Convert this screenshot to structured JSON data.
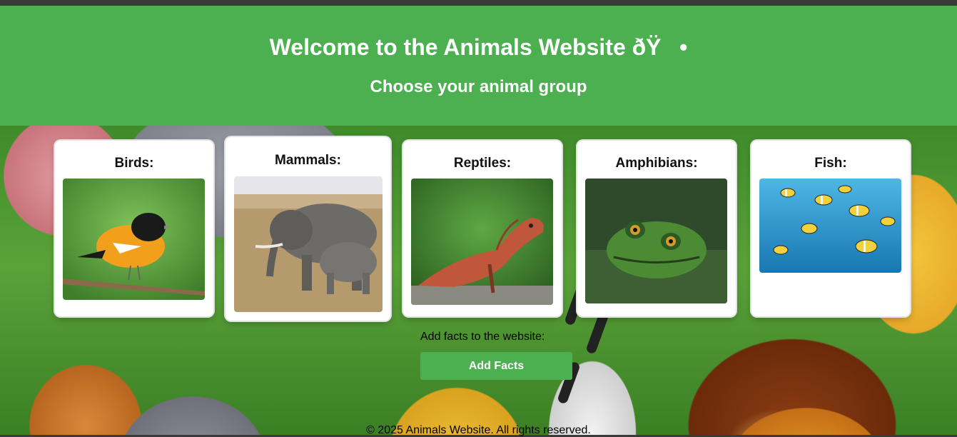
{
  "header": {
    "title": "Welcome to the Animals Website ðŸ•",
    "subtitle": "Choose your animal group"
  },
  "groups": [
    {
      "label": "Birds:",
      "image": "bird-photo"
    },
    {
      "label": "Mammals:",
      "image": "elephant-photo"
    },
    {
      "label": "Reptiles:",
      "image": "lizard-photo"
    },
    {
      "label": "Amphibians:",
      "image": "frog-photo"
    },
    {
      "label": "Fish:",
      "image": "fish-photo"
    }
  ],
  "add_facts": {
    "label": "Add facts to the website:",
    "button": "Add Facts"
  },
  "footer": {
    "text": "© 2025 Animals Website. All rights reserved."
  },
  "colors": {
    "header_bg": "#4caf50",
    "button_bg": "#4caf50",
    "topbar": "#3a3a3a"
  }
}
